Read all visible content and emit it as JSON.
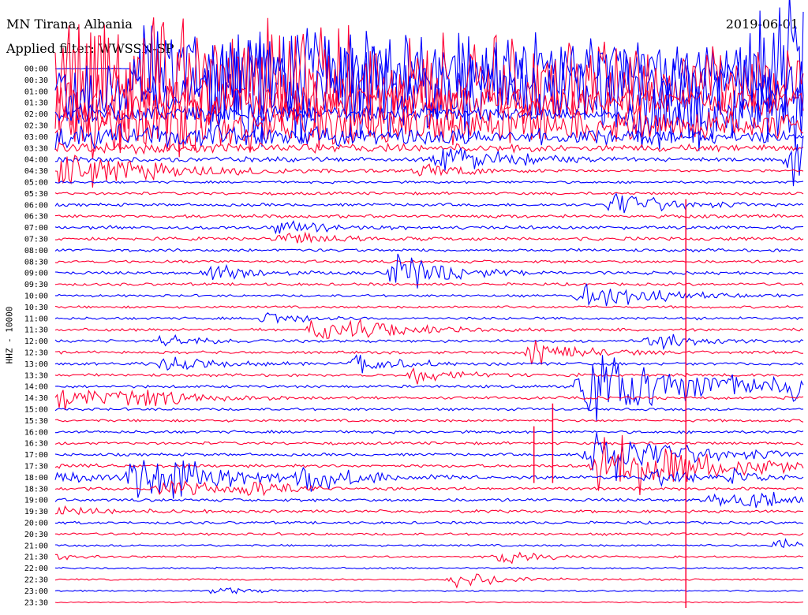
{
  "header": {
    "station": "MN Tirana, Albania",
    "filter": "Applied filter: WWSSN-SP",
    "date": "2019-06-01"
  },
  "chart_data": {
    "type": "helicorder",
    "ylabel": "HHZ - 10000",
    "row_labels": [
      "00:00",
      "00:30",
      "01:00",
      "01:30",
      "02:00",
      "02:30",
      "03:00",
      "03:30",
      "04:00",
      "04:30",
      "05:00",
      "05:30",
      "06:00",
      "06:30",
      "07:00",
      "07:30",
      "08:00",
      "08:30",
      "09:00",
      "09:30",
      "10:00",
      "10:30",
      "11:00",
      "11:30",
      "12:00",
      "12:30",
      "13:00",
      "13:30",
      "14:00",
      "14:30",
      "15:00",
      "15:30",
      "16:00",
      "16:30",
      "17:00",
      "17:30",
      "18:00",
      "18:30",
      "19:00",
      "19:30",
      "20:00",
      "20:30",
      "21:00",
      "21:30",
      "22:00",
      "22:30",
      "23:00",
      "23:30"
    ],
    "colors": [
      "#0000ff",
      "#ff0033"
    ],
    "noise_levels": [
      0.3,
      0.3,
      0.3,
      0.3,
      0.4,
      0.4,
      0.6,
      0.6,
      0.8,
      1.2,
      1.3,
      1.5,
      1.6,
      1.8,
      1.8,
      1.8,
      1.6,
      1.5,
      1.6,
      1.5,
      1.3,
      1.3,
      1.4,
      1.5,
      1.5,
      1.5,
      1.5,
      1.5,
      1.5,
      1.5,
      1.4,
      1.4,
      1.5,
      1.5,
      1.5,
      1.6,
      1.6,
      1.6,
      1.6,
      1.6,
      1.4,
      1.3,
      1.1,
      1.0,
      0.9,
      0.9,
      0.8,
      0.6
    ],
    "events": [
      {
        "row": 0,
        "t": 0.1,
        "amp": 60,
        "dur": 0.9
      },
      {
        "row": 2,
        "t": 0.19,
        "amp": 40,
        "dur": 1.0
      },
      {
        "row": 8,
        "t": 0.5,
        "amp": 14,
        "dur": 0.08
      },
      {
        "row": 9,
        "t": 0.47,
        "amp": 6,
        "dur": 0.08
      },
      {
        "row": 4,
        "t": 0.76,
        "amp": 35,
        "dur": 1.2
      },
      {
        "row": 12,
        "t": 0.73,
        "amp": 15,
        "dur": 0.06
      },
      {
        "row": 0,
        "t": 0.9,
        "amp": 60,
        "dur": 1.3
      },
      {
        "row": 8,
        "t": 0.97,
        "amp": 30,
        "dur": 0.1
      },
      {
        "row": 14,
        "t": 0.28,
        "amp": 8,
        "dur": 0.05
      },
      {
        "row": 15,
        "t": 0.29,
        "amp": 6,
        "dur": 0.06
      },
      {
        "row": 18,
        "t": 0.44,
        "amp": 22,
        "dur": 0.06
      },
      {
        "row": 18,
        "t": 0.19,
        "amp": 10,
        "dur": 0.05
      },
      {
        "row": 20,
        "t": 0.69,
        "amp": 18,
        "dur": 0.07
      },
      {
        "row": 22,
        "t": 0.26,
        "amp": 10,
        "dur": 0.04
      },
      {
        "row": 23,
        "t": 0.33,
        "amp": 14,
        "dur": 0.07
      },
      {
        "row": 23,
        "t": 0.39,
        "amp": 6,
        "dur": 0.05
      },
      {
        "row": 24,
        "t": 0.13,
        "amp": 8,
        "dur": 0.04
      },
      {
        "row": 25,
        "t": 0.62,
        "amp": 14,
        "dur": 0.06
      },
      {
        "row": 26,
        "t": 0.39,
        "amp": 12,
        "dur": 0.05
      },
      {
        "row": 26,
        "t": 0.13,
        "amp": 8,
        "dur": 0.06
      },
      {
        "row": 27,
        "t": 0.46,
        "amp": 8,
        "dur": 0.06
      },
      {
        "row": 24,
        "t": 0.78,
        "amp": 8,
        "dur": 0.05
      },
      {
        "row": 28,
        "t": 0.97,
        "amp": 10,
        "dur": 0.05
      },
      {
        "row": 29,
        "t": 0.09,
        "amp": 8,
        "dur": 0.05
      },
      {
        "row": 28,
        "t": 0.69,
        "amp": 40,
        "dur": 0.15
      },
      {
        "row": 34,
        "t": 0.7,
        "amp": 30,
        "dur": 0.1
      },
      {
        "row": 35,
        "t": 0.71,
        "amp": 40,
        "dur": 0.12
      },
      {
        "row": 36,
        "t": 0.09,
        "amp": 30,
        "dur": 0.1
      },
      {
        "row": 37,
        "t": 0.13,
        "amp": 10,
        "dur": 0.06
      },
      {
        "row": 36,
        "t": 0.32,
        "amp": 14,
        "dur": 0.05
      },
      {
        "row": 37,
        "t": 0.24,
        "amp": 8,
        "dur": 0.05
      },
      {
        "row": 36,
        "t": 0.78,
        "amp": 10,
        "dur": 0.04
      },
      {
        "row": 36,
        "t": 0.89,
        "amp": 8,
        "dur": 0.04
      },
      {
        "row": 38,
        "t": 0.9,
        "amp": 10,
        "dur": 0.08
      },
      {
        "row": 38,
        "t": 0.86,
        "amp": 6,
        "dur": 0.04
      },
      {
        "row": 42,
        "t": 0.95,
        "amp": 6,
        "dur": 0.04
      },
      {
        "row": 43,
        "t": 0.58,
        "amp": 8,
        "dur": 0.05
      },
      {
        "row": 45,
        "t": 0.52,
        "amp": 8,
        "dur": 0.06
      },
      {
        "row": 46,
        "t": 0.2,
        "amp": 5,
        "dur": 0.04
      }
    ],
    "spikes": [
      {
        "t": 0.843,
        "from": 12,
        "to": 47,
        "amp": 4
      },
      {
        "t": 0.665,
        "from": 30,
        "to": 36,
        "amp": 10
      },
      {
        "t": 0.64,
        "from": 32,
        "to": 36,
        "amp": 8
      }
    ],
    "grid": false
  }
}
